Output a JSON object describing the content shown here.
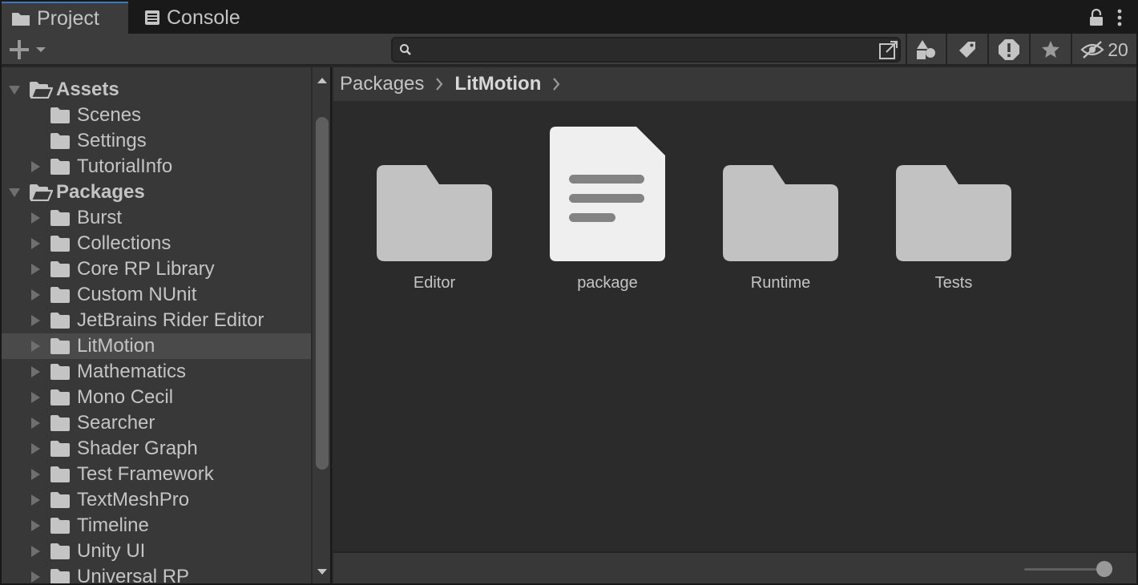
{
  "tabs": [
    {
      "label": "Project",
      "icon": "folder-icon",
      "active": true
    },
    {
      "label": "Console",
      "icon": "console-icon",
      "active": false
    }
  ],
  "toolbar": {
    "search_value": "",
    "search_placeholder": "",
    "hidden_count": "20"
  },
  "tree": {
    "assets": {
      "label": "Assets",
      "children": [
        "Scenes",
        "Settings",
        "TutorialInfo"
      ]
    },
    "packages": {
      "label": "Packages",
      "children": [
        "Burst",
        "Collections",
        "Core RP Library",
        "Custom NUnit",
        "JetBrains Rider Editor",
        "LitMotion",
        "Mathematics",
        "Mono Cecil",
        "Searcher",
        "Shader Graph",
        "Test Framework",
        "TextMeshPro",
        "Timeline",
        "Unity UI",
        "Universal RP"
      ],
      "selected": "LitMotion"
    }
  },
  "breadcrumb": [
    "Packages",
    "LitMotion"
  ],
  "items": [
    {
      "name": "Editor",
      "icon": "folder-icon"
    },
    {
      "name": "package",
      "icon": "document-icon"
    },
    {
      "name": "Runtime",
      "icon": "folder-icon"
    },
    {
      "name": "Tests",
      "icon": "folder-icon"
    }
  ],
  "colors": {
    "background": "#282828",
    "panel": "#383838",
    "content": "#2b2b2b",
    "selected_row": "#4a4a4a",
    "folder_thumb": "#c2c2c2",
    "document_thumb": "#efefef"
  },
  "zoom_slider_value": 1.0
}
